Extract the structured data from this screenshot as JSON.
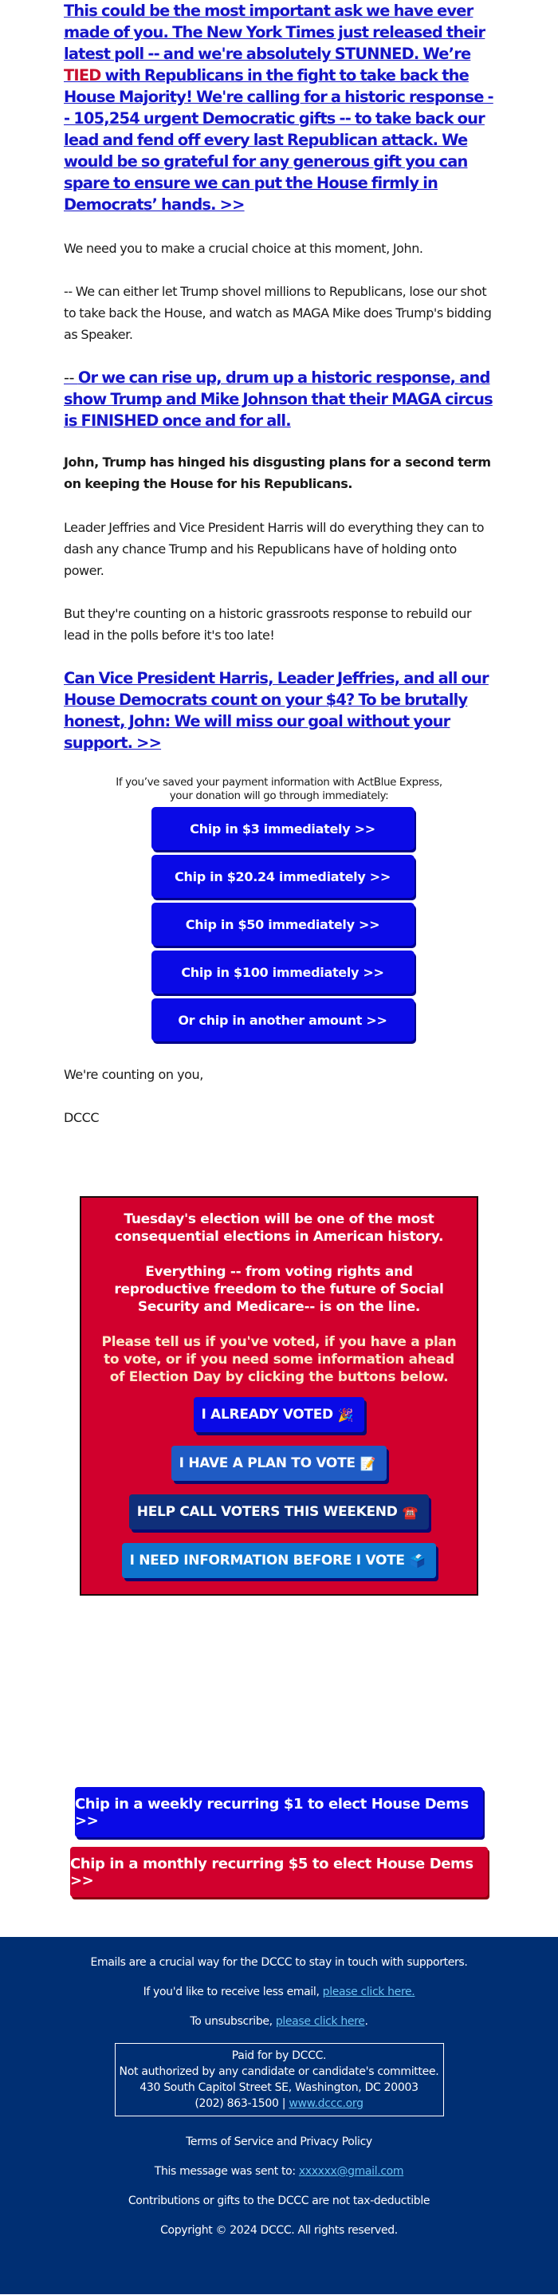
{
  "body": {
    "intro_link": {
      "part1": "This could be the most important ask we have ever made of you. The New York Times just released their latest poll -- and we're absolutely STUNNED. We’re ",
      "tied": "TIED",
      "part2": " with Republicans in the fight to take back the House Majority! We're calling for a historic response -- 105,254 urgent Democratic gifts -- to take back our lead and fend off every last Republican attack. We would be so grateful for any generous gift you can spare to ensure we can put the House firmly in Democrats’ hands. >>"
    },
    "choice": "We need you to make a crucial choice at this moment, John.",
    "either": "-- We can either let Trump shovel millions to Republicans, lose our shot to take back the House, and watch as MAGA Mike does Trump's bidding as Speaker.",
    "rise_prefix": "-- ",
    "rise_link": "Or we can rise up, drum up a historic response, and show Trump and Mike Johnson that their MAGA circus is FINISHED once and for all.",
    "hinged": "John, Trump has hinged his disgusting plans for a second term on keeping the House for his Republicans.",
    "jeffries": "Leader Jeffries and Vice President Harris will do everything they can to dash any chance Trump and his Republicans have of holding onto power.",
    "counting": "But they're counting on a historic grassroots response to rebuild our lead in the polls before it's too late!",
    "cta_link": "Can Vice President Harris, Leader Jeffries, and all our House Democrats count on your $4? To be brutally honest, John: We will miss our goal without your support. >>",
    "express_note_line1": "If you’ve saved your payment information with ActBlue Express,",
    "express_note_line2": "your donation will go through immediately:",
    "donate_buttons": [
      "Chip in $3 immediately >>",
      "Chip in $20.24 immediately >>",
      "Chip in $50 immediately >>",
      "Chip in $100 immediately >>",
      "Or chip in another amount >>"
    ],
    "closing": "We're counting on you,",
    "signature": "DCCC"
  },
  "vote_box": {
    "para1": "Tuesday's election will be one of the most consequential elections in American history.",
    "para2": "Everything -- from voting rights and reproductive freedom to the future of Social Security and Medicare-- is on the line.",
    "para3": "Please tell us if you've voted, if you have a plan to vote, or if you need some information ahead of Election Day by clicking the buttons below.",
    "buttons": [
      {
        "label": "I ALREADY VOTED",
        "emoji": "🎉",
        "icon": "party-popper-icon"
      },
      {
        "label": "I HAVE A PLAN TO VOTE",
        "emoji": "📝",
        "icon": "memo-icon"
      },
      {
        "label": "HELP CALL VOTERS THIS WEEKEND",
        "emoji": "☎️",
        "icon": "telephone-icon"
      },
      {
        "label": "I NEED INFORMATION BEFORE I VOTE",
        "emoji": "🗳️",
        "icon": "ballot-box-icon"
      }
    ],
    "colors": {
      "background": "#d1002d",
      "voted": "#0a0ae6",
      "plan": "#1f5bc4",
      "call": "#0f2f7a",
      "info": "#0e74cc"
    }
  },
  "recurring": {
    "weekly": "Chip in a weekly recurring $1 to elect House Dems >>",
    "monthly": "Chip in a monthly recurring $5 to elect House Dems >>"
  },
  "footer": {
    "emails_note": "Emails are a crucial way for the DCCC to stay in touch with supporters.",
    "less_email_prefix": "If you'd like to receive less email, ",
    "less_email_link": "please click here.",
    "unsubscribe_prefix": "To unsubscribe, ",
    "unsubscribe_link": "please click here",
    "unsubscribe_suffix": ".",
    "disclaimer": {
      "line1": "Paid for by DCCC.",
      "line2": "Not authorized by any candidate or candidate's committee.",
      "line3": "430 South Capitol Street SE, Washington, DC 20003",
      "phone": "(202) 863-1500 | ",
      "website": "www.dccc.org"
    },
    "terms": "Terms of Service and Privacy Policy",
    "sent_to_prefix": "This message was sent to: ",
    "sent_to_email": "xxxxxx@gmail.com",
    "tax_note": "Contributions or gifts to the DCCC are not tax-deductible",
    "copyright": "Copyright © 2024 DCCC. All rights reserved.",
    "colors": {
      "background": "#002f73",
      "link": "#6cc4f5"
    }
  },
  "colors": {
    "link_blue": "#1515c8",
    "tied_red": "#c8102e",
    "button_blue": "#0a0ae6"
  }
}
